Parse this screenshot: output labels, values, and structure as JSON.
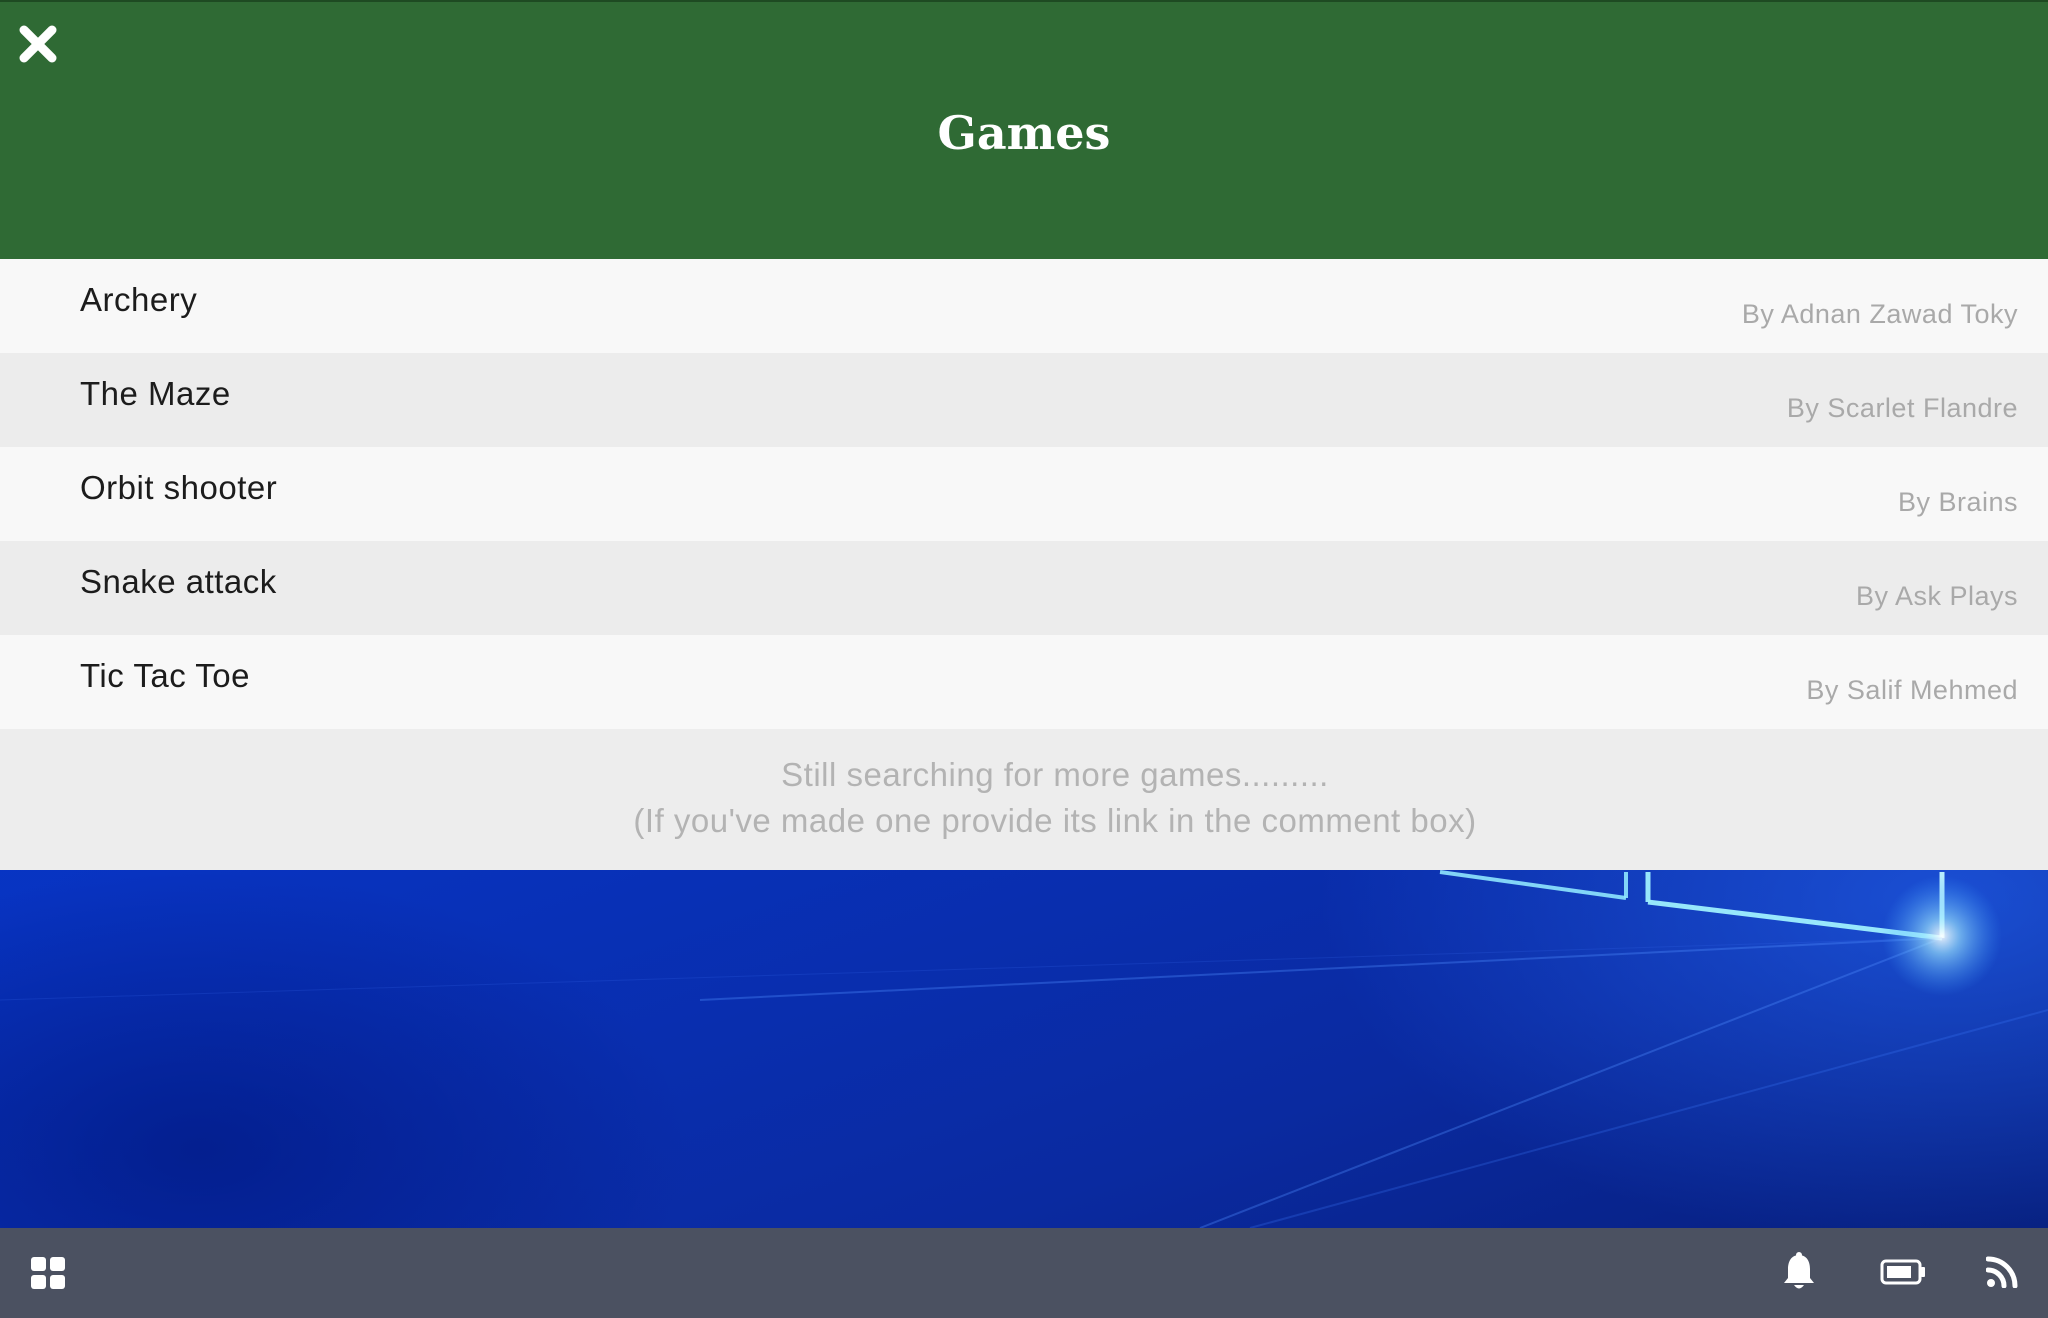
{
  "panel": {
    "title": "Games",
    "close_icon": "close-icon",
    "header_color": "#2f6a34"
  },
  "games": [
    {
      "name": "Archery",
      "author": "By Adnan Zawad Toky"
    },
    {
      "name": "The Maze",
      "author": "By Scarlet Flandre"
    },
    {
      "name": "Orbit shooter",
      "author": "By Brains"
    },
    {
      "name": "Snake attack",
      "author": "By Ask Plays"
    },
    {
      "name": "Tic Tac Toe",
      "author": "By Salif Mehmed"
    }
  ],
  "more_note": {
    "line1": "Still searching for more games.........",
    "line2": "(If you've made one provide its link in the comment box)"
  },
  "taskbar": {
    "start_icon": "windows-grid-icon",
    "notification_icon": "bell-icon",
    "battery_icon": "battery-icon",
    "network_icon": "rss-feed-icon",
    "color": "#4b5161"
  }
}
